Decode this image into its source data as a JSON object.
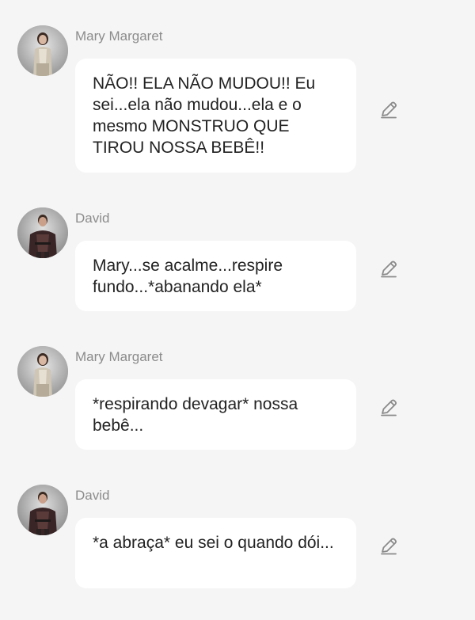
{
  "messages": [
    {
      "author": "Mary Margaret",
      "avatar_icon": "mary-margaret-avatar",
      "text": "NÃO!! ELA NÃO MUDOU!! Eu sei...ela não mudou...ela e o mesmo MONSTRUO QUE TIROU NOSSA BEBÊ!!"
    },
    {
      "author": "David",
      "avatar_icon": "david-avatar",
      "text": "Mary...se acalme...respire fundo...*abanando ela*"
    },
    {
      "author": "Mary Margaret",
      "avatar_icon": "mary-margaret-avatar",
      "text": "*respirando devagar* nossa bebê..."
    },
    {
      "author": "David",
      "avatar_icon": "david-avatar",
      "text": "*a abraça* eu sei o quando dói..."
    }
  ],
  "colors": {
    "background": "#f5f5f5",
    "bubble": "#ffffff",
    "author": "#8c8c8c",
    "text": "#222222",
    "edit_icon": "#8a8a8a"
  }
}
